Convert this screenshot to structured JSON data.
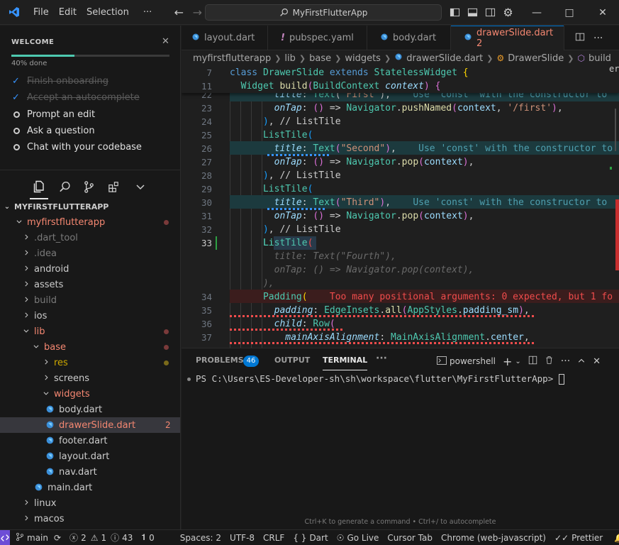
{
  "menu": {
    "file": "File",
    "edit": "Edit",
    "selection": "Selection",
    "more": "···"
  },
  "search": {
    "text": "MyFirstFlutterApp"
  },
  "welcome": {
    "title": "WELCOME",
    "progress_text": "40% done",
    "progress_fraction": 0.4,
    "steps": [
      {
        "label": "Finish onboarding",
        "done": true
      },
      {
        "label": "Accept an autocomplete",
        "done": true
      },
      {
        "label": "Prompt an edit",
        "done": false
      },
      {
        "label": "Ask a question",
        "done": false
      },
      {
        "label": "Chat with your codebase",
        "done": false
      }
    ]
  },
  "explorer": {
    "root": "MYFIRSTFLUTTERAPP",
    "items": [
      {
        "label": "myfirstflutterapp"
      },
      {
        "label": ".dart_tool"
      },
      {
        "label": ".idea"
      },
      {
        "label": "android"
      },
      {
        "label": "assets"
      },
      {
        "label": "build"
      },
      {
        "label": "ios"
      },
      {
        "label": "lib"
      },
      {
        "label": "base"
      },
      {
        "label": "res"
      },
      {
        "label": "screens"
      },
      {
        "label": "widgets"
      },
      {
        "label": "body.dart"
      },
      {
        "label": "drawerSlide.dart",
        "badge": "2"
      },
      {
        "label": "footer.dart"
      },
      {
        "label": "layout.dart"
      },
      {
        "label": "nav.dart"
      },
      {
        "label": "main.dart"
      },
      {
        "label": "linux"
      },
      {
        "label": "macos"
      }
    ]
  },
  "tabs": [
    {
      "label": "layout.dart"
    },
    {
      "label": "pubspec.yaml"
    },
    {
      "label": "body.dart"
    },
    {
      "label": "drawerSlide.dart 2"
    }
  ],
  "breadcrumb": [
    "myfirstflutterapp",
    "lib",
    "base",
    "widgets",
    "drawerSlide.dart",
    "DrawerSlide",
    "build"
  ],
  "editor": {
    "sticky": [
      {
        "ln": "7",
        "code": "class DrawerSlide extends StatelessWidget {"
      },
      {
        "ln": "11",
        "code": "Widget build(BuildContext context) {"
      }
    ],
    "lines": [
      {
        "ln": "22"
      },
      {
        "ln": "23"
      },
      {
        "ln": "24"
      },
      {
        "ln": "25"
      },
      {
        "ln": "26"
      },
      {
        "ln": "27"
      },
      {
        "ln": "28"
      },
      {
        "ln": "29"
      },
      {
        "ln": "30"
      },
      {
        "ln": "31"
      },
      {
        "ln": "32"
      },
      {
        "ln": "33"
      },
      {
        "ln": "34"
      },
      {
        "ln": "35"
      },
      {
        "ln": "36"
      },
      {
        "ln": "37"
      }
    ],
    "hint_const": "Use 'const' with the constructor to",
    "error_msg": "Too many positional arguments: 0 expected, but 1 fo",
    "minimap_fragment": "er"
  },
  "panel": {
    "tabs": [
      "PROBLEMS",
      "OUTPUT",
      "TERMINAL"
    ],
    "problems_count": "46",
    "shell": "powershell",
    "prompt": "PS C:\\Users\\ES-Developer-sh\\sh\\workspace\\flutter\\MyFirstFlutterApp> ",
    "hint": "Ctrl+K to generate a command • Ctrl+/ to autocomplete"
  },
  "status": {
    "branch": "main",
    "errors": "2",
    "warnings": "1",
    "infos": "43",
    "ports": "0",
    "spaces": "Spaces: 2",
    "encoding": "UTF-8",
    "eol": "CRLF",
    "language": "Dart",
    "golive": "Go Live",
    "cursortab": "Cursor Tab",
    "debug": "Chrome (web-javascript)",
    "prettier": "Prettier"
  },
  "colors": {
    "accent": "#0078d4",
    "error": "#f48771",
    "warning": "#cca700",
    "progress": "#4ec9b0"
  }
}
